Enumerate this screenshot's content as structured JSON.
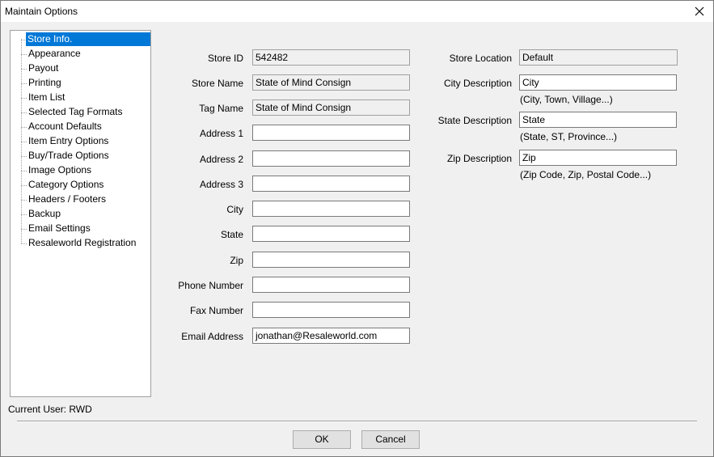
{
  "window": {
    "title": "Maintain Options"
  },
  "tree": {
    "items": [
      {
        "label": "Store Info.",
        "selected": true
      },
      {
        "label": "Appearance"
      },
      {
        "label": "Payout"
      },
      {
        "label": "Printing"
      },
      {
        "label": "Item List"
      },
      {
        "label": "Selected Tag Formats"
      },
      {
        "label": "Account Defaults"
      },
      {
        "label": "Item Entry Options"
      },
      {
        "label": "Buy/Trade Options"
      },
      {
        "label": "Image Options"
      },
      {
        "label": "Category Options"
      },
      {
        "label": "Headers / Footers"
      },
      {
        "label": "Backup"
      },
      {
        "label": "Email Settings"
      },
      {
        "label": "Resaleworld Registration"
      }
    ]
  },
  "store": {
    "store_id": {
      "label": "Store ID",
      "value": "542482"
    },
    "store_name": {
      "label": "Store Name",
      "value": "State of Mind Consign"
    },
    "tag_name": {
      "label": "Tag Name",
      "value": "State of Mind Consign"
    },
    "address1": {
      "label": "Address 1",
      "value": ""
    },
    "address2": {
      "label": "Address 2",
      "value": ""
    },
    "address3": {
      "label": "Address 3",
      "value": ""
    },
    "city": {
      "label": "City",
      "value": ""
    },
    "state": {
      "label": "State",
      "value": ""
    },
    "zip": {
      "label": "Zip",
      "value": ""
    },
    "phone": {
      "label": "Phone Number",
      "value": ""
    },
    "fax": {
      "label": "Fax Number",
      "value": ""
    },
    "email": {
      "label": "Email Address",
      "value": "jonathan@Resaleworld.com"
    }
  },
  "location": {
    "store_location": {
      "label": "Store Location",
      "value": "Default"
    },
    "city_desc": {
      "label": "City Description",
      "value": "City",
      "hint": "(City, Town, Village...)"
    },
    "state_desc": {
      "label": "State Description",
      "value": "State",
      "hint": "(State, ST, Province...)"
    },
    "zip_desc": {
      "label": "Zip Description",
      "value": "Zip",
      "hint": "(Zip Code, Zip, Postal Code...)"
    }
  },
  "footer": {
    "current_user": "Current User: RWD",
    "ok_label": "OK",
    "cancel_label": "Cancel"
  }
}
